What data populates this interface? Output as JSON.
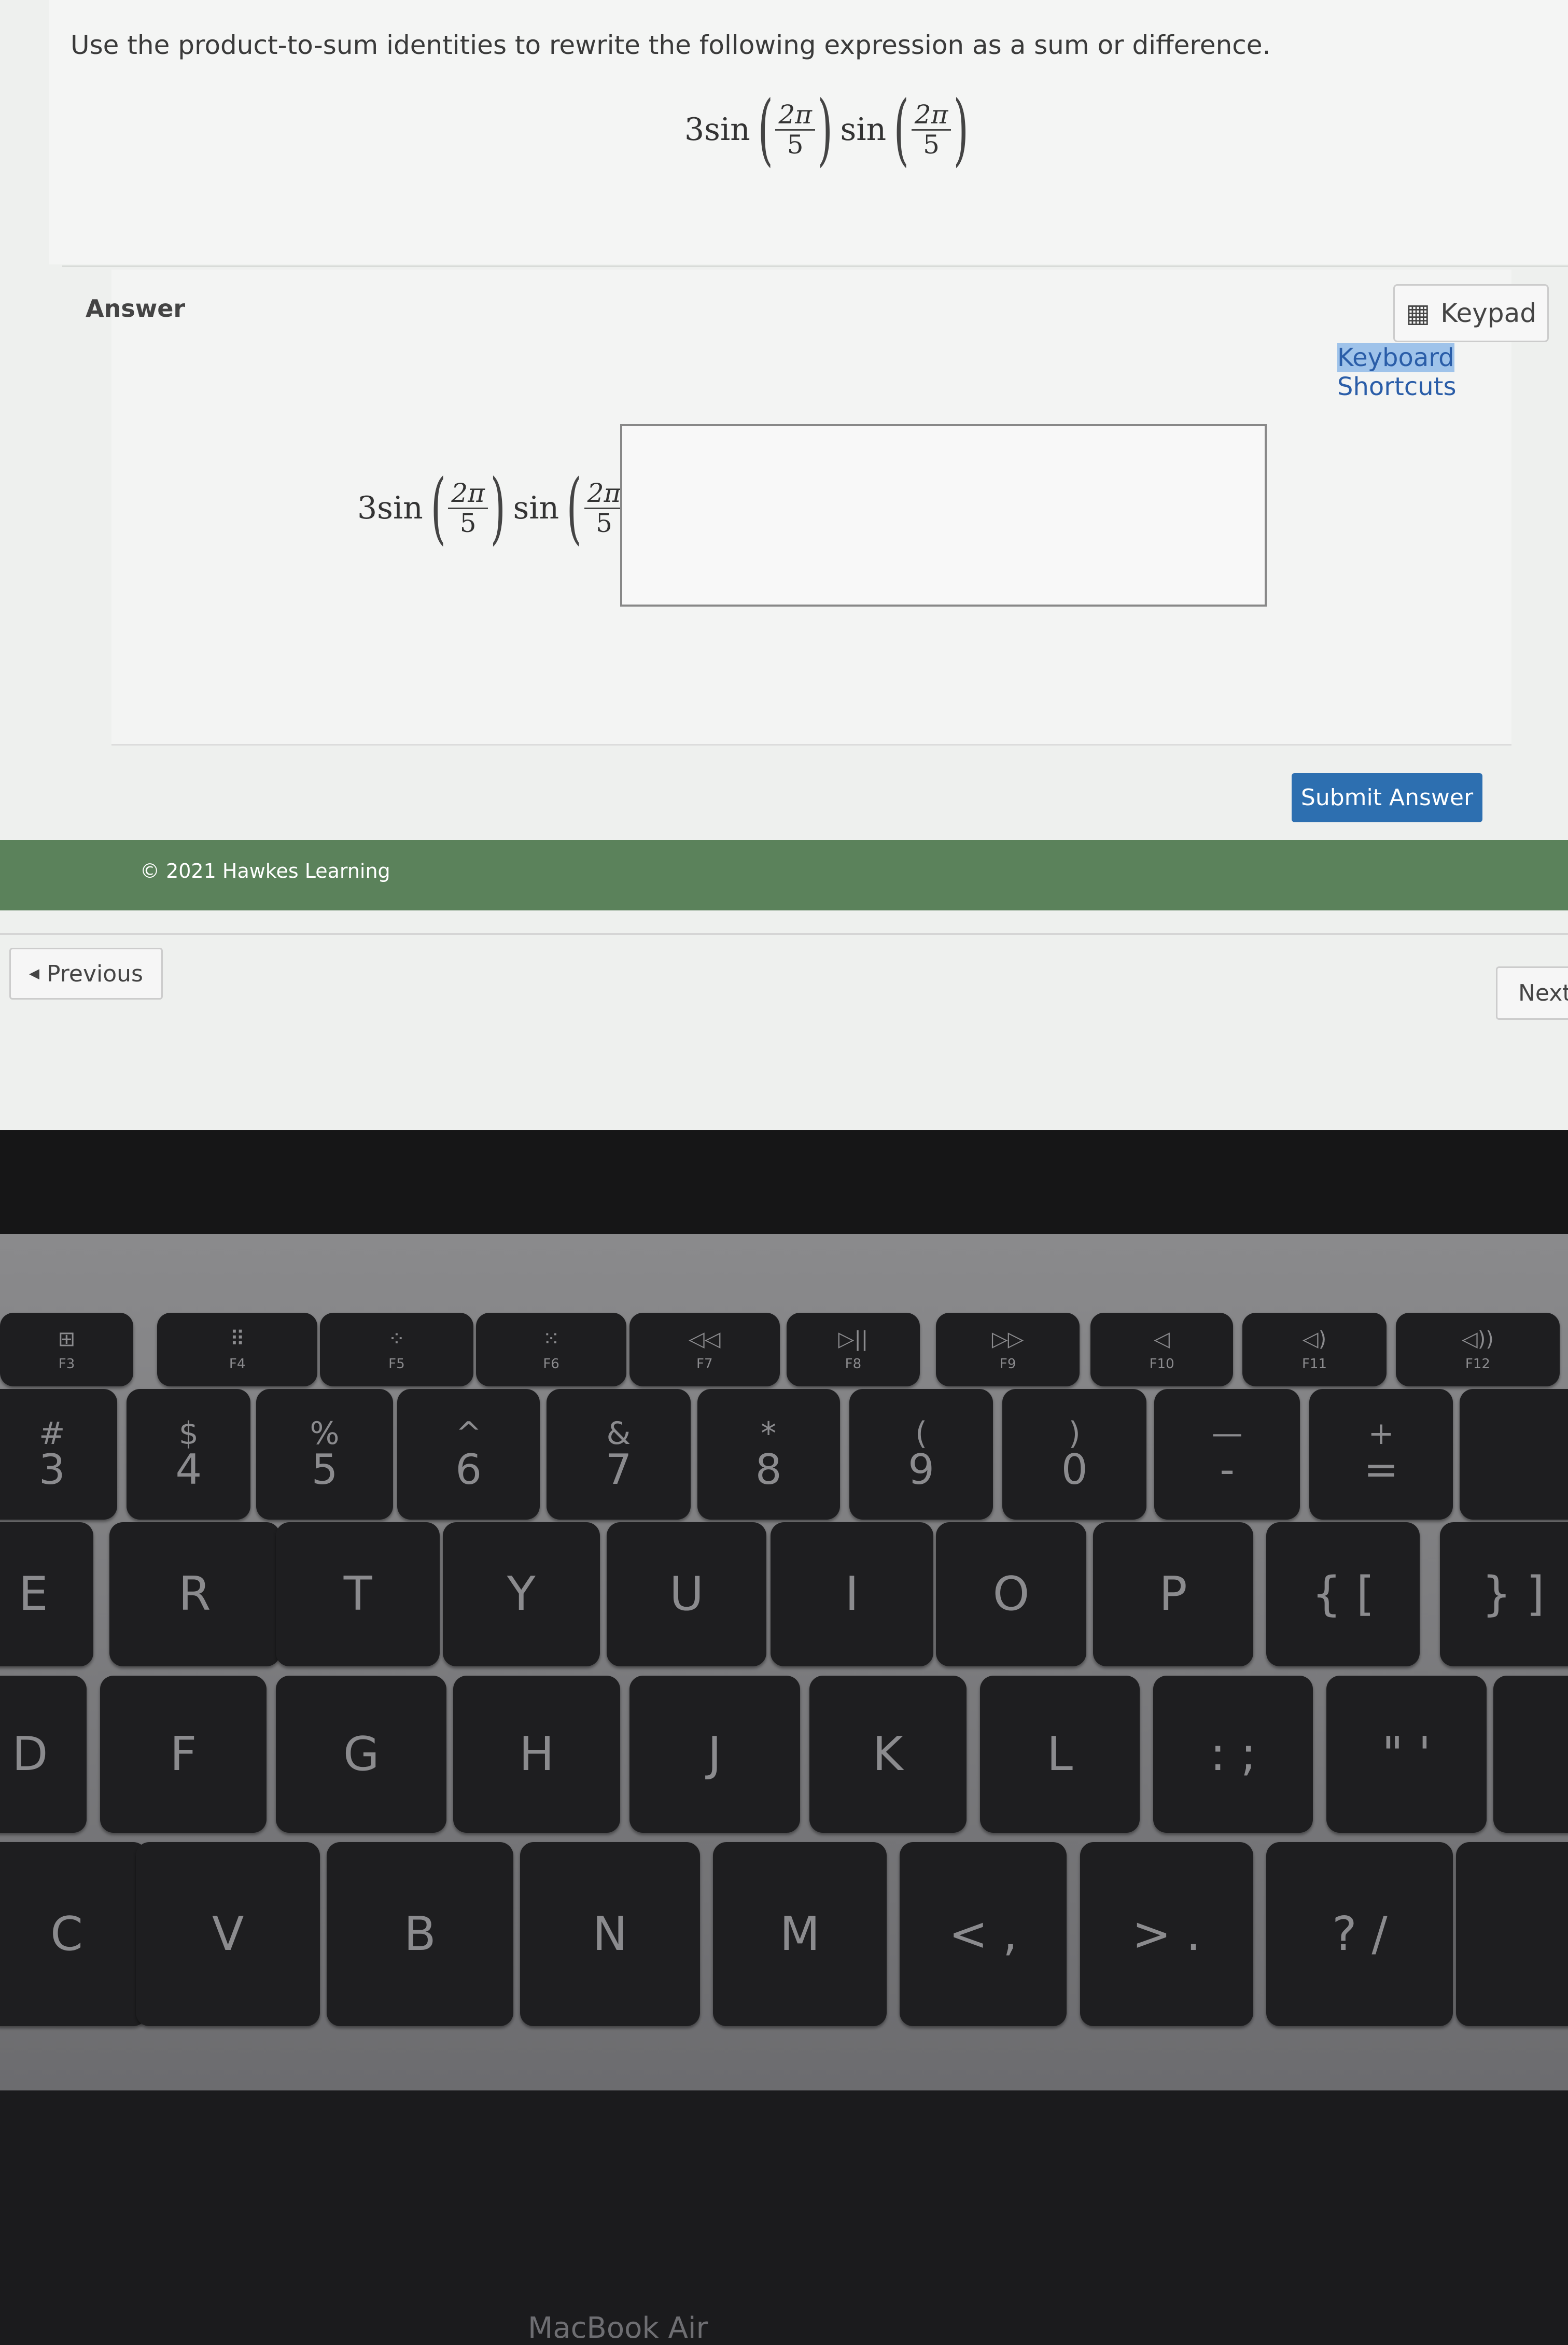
{
  "question": {
    "instruction": "Use the product-to-sum identities to rewrite the following expression as a sum or difference.",
    "expression": {
      "coef": "3sin",
      "func2": "sin",
      "num": "2π",
      "den": "5"
    }
  },
  "answer": {
    "label": "Answer",
    "keypad_label": "Keypad",
    "keyboard_shortcuts_part1": "Keyboard",
    "keyboard_shortcuts_part2": " Shortcuts",
    "lhs": {
      "coef": "3sin",
      "func2": "sin",
      "num": "2π",
      "den": "5",
      "equals": "="
    },
    "input_value": "",
    "submit_label": "Submit Answer"
  },
  "footer": {
    "copyright": "© 2021 Hawkes Learning",
    "color": "#5b825b"
  },
  "nav": {
    "previous_label": "Previous",
    "next_label": "Next"
  },
  "device": {
    "brand": "MacBook Air"
  },
  "keyboard": {
    "fn_row": [
      {
        "label": "F3",
        "icon": "⊞"
      },
      {
        "label": "F4",
        "icon": "⠿"
      },
      {
        "label": "F5",
        "icon": "⁘"
      },
      {
        "label": "F6",
        "icon": "⁙"
      },
      {
        "label": "F7",
        "icon": "◁◁"
      },
      {
        "label": "F8",
        "icon": "▷||"
      },
      {
        "label": "F9",
        "icon": "▷▷"
      },
      {
        "label": "F10",
        "icon": "◁"
      },
      {
        "label": "F11",
        "icon": "◁)"
      },
      {
        "label": "F12",
        "icon": "◁))"
      }
    ],
    "num_row": [
      {
        "top": "#",
        "bot": "3"
      },
      {
        "top": "$",
        "bot": "4"
      },
      {
        "top": "%",
        "bot": "5"
      },
      {
        "top": "^",
        "bot": "6"
      },
      {
        "top": "&",
        "bot": "7"
      },
      {
        "top": "*",
        "bot": "8"
      },
      {
        "top": "(",
        "bot": "9"
      },
      {
        "top": ")",
        "bot": "0"
      },
      {
        "top": "—",
        "bot": "-"
      },
      {
        "top": "+",
        "bot": "="
      },
      {
        "top": "",
        "bot": ""
      }
    ],
    "row_q": [
      "E",
      "R",
      "T",
      "Y",
      "U",
      "I",
      "O",
      "P",
      "{ [",
      "} ]"
    ],
    "row_a": [
      "D",
      "F",
      "G",
      "H",
      "J",
      "K",
      "L",
      ": ;",
      "\" '",
      ""
    ],
    "row_z": [
      "C",
      "V",
      "B",
      "N",
      "M",
      "< ,",
      "> .",
      "? /",
      ""
    ]
  }
}
